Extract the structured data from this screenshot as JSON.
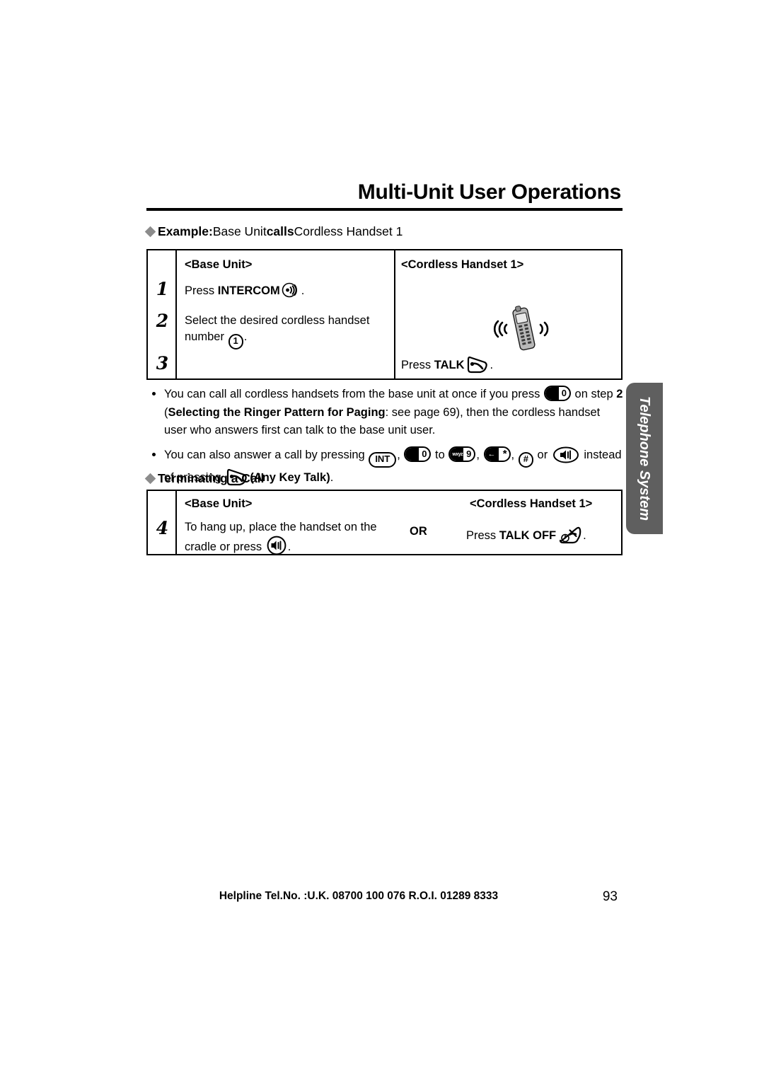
{
  "header": {
    "title": "Multi-Unit User Operations"
  },
  "sections": [
    {
      "id": "example",
      "heading_bold_1": "Example:",
      "heading_normal_1": " Base Unit ",
      "heading_bold_2": "calls",
      "heading_normal_2": " Cordless Handset 1"
    },
    {
      "id": "terminating",
      "heading": "Terminating a Call"
    }
  ],
  "example_table": {
    "col_headers": {
      "left": "<Base Unit>",
      "right": "<Cordless Handset 1>"
    },
    "steps": [
      {
        "number": "1",
        "left_prefix": "Press ",
        "left_bold": "INTERCOM",
        "left_suffix": ".",
        "left_icon": "intercom-icon",
        "right": ""
      },
      {
        "number": "2",
        "left_line1": "Select the desired cordless handset",
        "left_line2_prefix": "number ",
        "left_key": "1",
        "left_line2_suffix": ".",
        "right_icon": "cordless-handset-ringing-illustration"
      },
      {
        "number": "3",
        "left": "",
        "right_prefix": "Press ",
        "right_bold": "TALK",
        "right_icon": "talk-key-icon",
        "right_suffix": "."
      }
    ]
  },
  "notes": [
    {
      "id": "note-call-all",
      "part1": "You can call all cordless handsets from the base unit at once if you press ",
      "key": "0",
      "part2": " on step ",
      "bold_step": "2",
      "part3": " (",
      "bold_ref": "Selecting the Ringer Pattern for Paging",
      "part4": ": see page 69), then the cordless handset user who answers first can talk to the base unit user."
    },
    {
      "id": "note-any-key-talk",
      "part1": "You can also answer a call by pressing ",
      "keys": [
        "INT",
        "0",
        "wxyz9",
        "←∗",
        "#",
        "speakerphone-key-icon"
      ],
      "key_separators": [
        ", ",
        " to ",
        ", ",
        ", ",
        " or "
      ],
      "part2": " instead of pressing ",
      "talk_icon": "talk-key-icon",
      "bold_label": "(Any Key Talk)",
      "part3": "."
    }
  ],
  "terminating_table": {
    "col_headers": {
      "left": "<Base Unit>",
      "right": "<Cordless Handset 1>"
    },
    "or_label": "OR",
    "steps": [
      {
        "number": "4",
        "left_line1": "To hang up, place the handset on the",
        "left_line2_prefix": "cradle or press ",
        "left_icon": "speakerphone-key-icon",
        "left_line2_suffix": ".",
        "right_prefix": "Press ",
        "right_bold": "TALK OFF",
        "right_icon": "talk-off-key-icon",
        "right_suffix": "."
      }
    ]
  },
  "side_tab": {
    "label": "Telephone System",
    "color": "#5f5f5f"
  },
  "footer": {
    "helpline": "Helpline Tel.No. :U.K. 08700 100 076  R.O.I. 01289 8333",
    "page_number": "93"
  }
}
